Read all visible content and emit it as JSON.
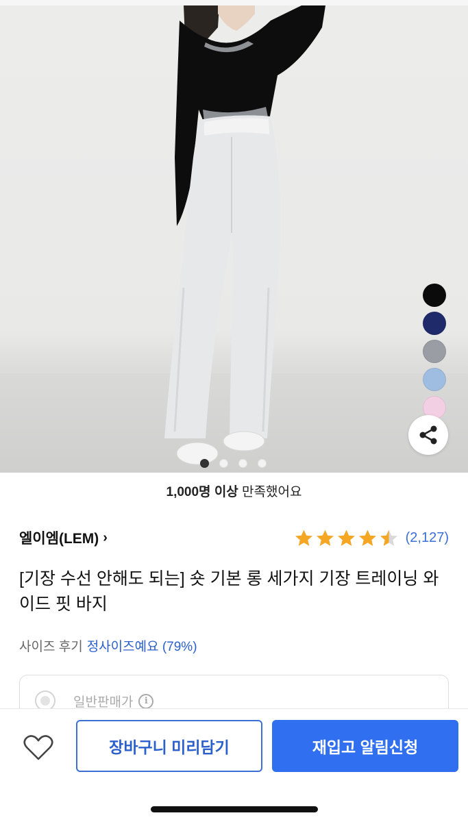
{
  "product_image": {
    "swatches": [
      {
        "name": "black",
        "color": "#0b0b0b"
      },
      {
        "name": "navy",
        "color": "#1f2a6b"
      },
      {
        "name": "gray",
        "color": "#9a9da3"
      },
      {
        "name": "light-blue",
        "color": "#9fbde0"
      },
      {
        "name": "pink",
        "color": "#f3cfe3"
      }
    ],
    "carousel": {
      "total": 4,
      "current": 1
    }
  },
  "satisfaction": {
    "bold": "1,000명 이상",
    "rest": " 만족했어요"
  },
  "brand": {
    "name": "엘이엠(LEM)",
    "chevron": "›"
  },
  "rating": {
    "value": 4.5,
    "max": 5,
    "count_text": "(2,127)",
    "star_color": "#f5a623"
  },
  "product": {
    "title": "[기장 수선 안해도 되는] 숏 기본 롱 세가지 기장 트레이닝 와이드 핏 바지"
  },
  "size_review": {
    "label": "사이즈 후기",
    "value": "정사이즈예요 (79%)"
  },
  "option": {
    "label": "일반판매가",
    "info_glyph": "i"
  },
  "actions": {
    "cart_label": "장바구니 미리담기",
    "restock_label": "재입고 알림신청"
  },
  "colors": {
    "accent": "#2f6ff0",
    "link": "#2a5fcc"
  }
}
